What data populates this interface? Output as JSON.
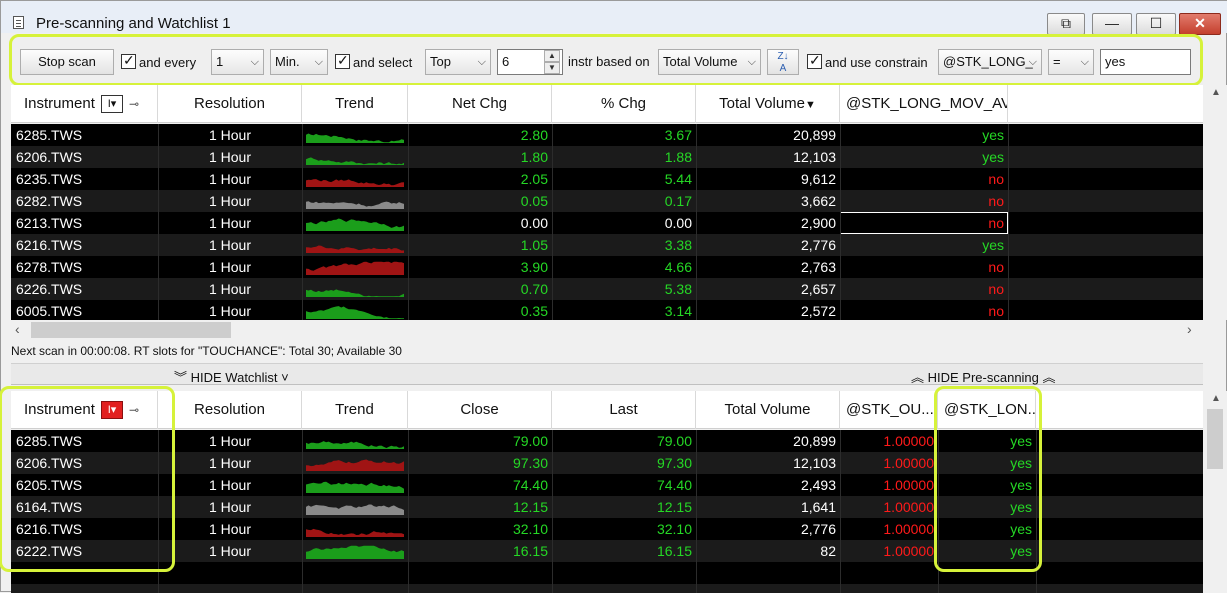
{
  "window": {
    "title": "Pre-scanning and Watchlist 1"
  },
  "titlebar_buttons": {
    "restore": "⧉",
    "minimize": "—",
    "maximize": "☐",
    "close": "✕"
  },
  "toolbar": {
    "stop_scan": "Stop scan",
    "and_every_label": "and every",
    "every_value": "1",
    "unit_value": "Min.",
    "and_select_label": "and select",
    "select_value": "Top",
    "count_value": "6",
    "based_on_label": "instr based on",
    "based_on_value": "Total Volume",
    "use_constrain_label": "and use constrain",
    "constrain_field": "@STK_LONG_",
    "operator": "=",
    "constrain_value": "yes"
  },
  "prescan": {
    "headers": [
      "Instrument",
      "Resolution",
      "Trend",
      "Net Chg",
      "% Chg",
      "Total Volume",
      "@STK_LONG_MOV_AVG"
    ],
    "sort_indicator": "▼",
    "rows": [
      {
        "inst": "6285.TWS",
        "res": "1 Hour",
        "trend": "green",
        "netchg": "2.80",
        "pct": "3.67",
        "vol": "20,899",
        "cond": "yes",
        "cond_color": "green",
        "chg_color": "green"
      },
      {
        "inst": "6206.TWS",
        "res": "1 Hour",
        "trend": "green",
        "netchg": "1.80",
        "pct": "1.88",
        "vol": "12,103",
        "cond": "yes",
        "cond_color": "green",
        "chg_color": "green"
      },
      {
        "inst": "6235.TWS",
        "res": "1 Hour",
        "trend": "red",
        "netchg": "2.05",
        "pct": "5.44",
        "vol": "9,612",
        "cond": "no",
        "cond_color": "red",
        "chg_color": "green"
      },
      {
        "inst": "6282.TWS",
        "res": "1 Hour",
        "trend": "gray",
        "netchg": "0.05",
        "pct": "0.17",
        "vol": "3,662",
        "cond": "no",
        "cond_color": "red",
        "chg_color": "green"
      },
      {
        "inst": "6213.TWS",
        "res": "1 Hour",
        "trend": "green",
        "netchg": "0.00",
        "pct": "0.00",
        "vol": "2,900",
        "cond": "no",
        "cond_color": "red",
        "chg_color": "white"
      },
      {
        "inst": "6216.TWS",
        "res": "1 Hour",
        "trend": "red",
        "netchg": "1.05",
        "pct": "3.38",
        "vol": "2,776",
        "cond": "yes",
        "cond_color": "green",
        "chg_color": "green"
      },
      {
        "inst": "6278.TWS",
        "res": "1 Hour",
        "trend": "red",
        "netchg": "3.90",
        "pct": "4.66",
        "vol": "2,763",
        "cond": "no",
        "cond_color": "red",
        "chg_color": "green"
      },
      {
        "inst": "6226.TWS",
        "res": "1 Hour",
        "trend": "green",
        "netchg": "0.70",
        "pct": "5.38",
        "vol": "2,657",
        "cond": "no",
        "cond_color": "red",
        "chg_color": "green"
      },
      {
        "inst": "6005.TWS",
        "res": "1 Hour",
        "trend": "green",
        "netchg": "0.35",
        "pct": "3.14",
        "vol": "2,572",
        "cond": "no",
        "cond_color": "red",
        "chg_color": "green"
      }
    ]
  },
  "status": {
    "text": "Next scan in 00:00:08. RT slots for \"TOUCHANCE\": Total 30; Available 30"
  },
  "splitbar": {
    "hide_watchlist": "HIDE Watchlist",
    "hide_prescanning": "HIDE Pre-scanning"
  },
  "watchlist": {
    "headers": [
      "Instrument",
      "Resolution",
      "Trend",
      "Close",
      "Last",
      "Total Volume",
      "@STK_OU...",
      "@STK_LON..."
    ],
    "rows": [
      {
        "inst": "6285.TWS",
        "res": "1 Hour",
        "trend": "green",
        "close": "79.00",
        "last": "79.00",
        "vol": "20,899",
        "ou": "1.00000",
        "lon": "yes"
      },
      {
        "inst": "6206.TWS",
        "res": "1 Hour",
        "trend": "red",
        "close": "97.30",
        "last": "97.30",
        "vol": "12,103",
        "ou": "1.00000",
        "lon": "yes"
      },
      {
        "inst": "6205.TWS",
        "res": "1 Hour",
        "trend": "green",
        "close": "74.40",
        "last": "74.40",
        "vol": "2,493",
        "ou": "1.00000",
        "lon": "yes"
      },
      {
        "inst": "6164.TWS",
        "res": "1 Hour",
        "trend": "gray",
        "close": "12.15",
        "last": "12.15",
        "vol": "1,641",
        "ou": "1.00000",
        "lon": "yes"
      },
      {
        "inst": "6216.TWS",
        "res": "1 Hour",
        "trend": "red",
        "close": "32.10",
        "last": "32.10",
        "vol": "2,776",
        "ou": "1.00000",
        "lon": "yes"
      },
      {
        "inst": "6222.TWS",
        "res": "1 Hour",
        "trend": "green",
        "close": "16.15",
        "last": "16.15",
        "vol": "82",
        "ou": "1.00000",
        "lon": "yes"
      }
    ]
  },
  "colors": {
    "highlight": "#d6f23a",
    "up": "#25d825",
    "down": "#ff1a1a"
  }
}
